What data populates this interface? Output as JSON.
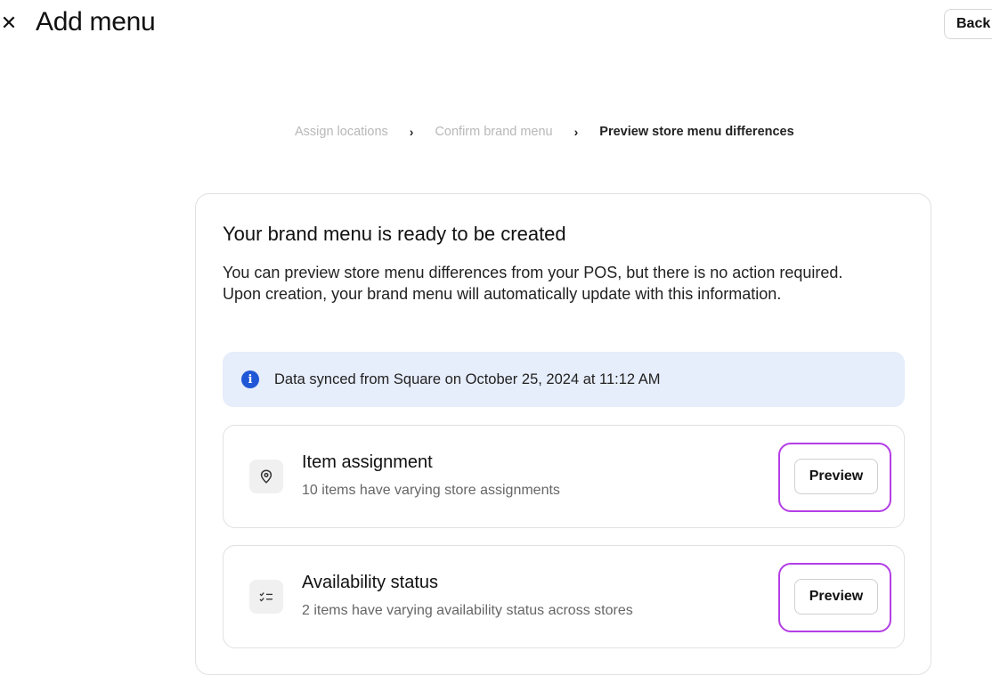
{
  "header": {
    "close_icon": "close-icon",
    "title": "Add menu",
    "back_label": "Back"
  },
  "breadcrumb": {
    "steps": [
      {
        "label": "Assign locations",
        "state": "completed"
      },
      {
        "label": "Confirm brand menu",
        "state": "completed"
      },
      {
        "label": "Preview store menu differences",
        "state": "current"
      }
    ],
    "separator_icon": "chevron-right-icon"
  },
  "card": {
    "title": "Your brand menu is ready to be created",
    "description": "You can preview store menu differences from your POS, but there is no action required. Upon creation, your brand menu will automatically update with this information.",
    "info_banner": {
      "icon": "info-icon",
      "text": "Data synced from Square on October 25, 2024 at 11:12 AM"
    },
    "rows": [
      {
        "icon": "location-pin-icon",
        "title": "Item assignment",
        "subtitle": "10 items have varying store assignments",
        "button_label": "Preview"
      },
      {
        "icon": "checklist-icon",
        "title": "Availability status",
        "subtitle": "2 items have varying availability status across stores",
        "button_label": "Preview"
      }
    ]
  },
  "colors": {
    "info_banner_bg": "#e6edfb",
    "info_icon": "#1f57d6",
    "highlight": "#b43ee6",
    "muted_text": "#b8b8b8"
  }
}
